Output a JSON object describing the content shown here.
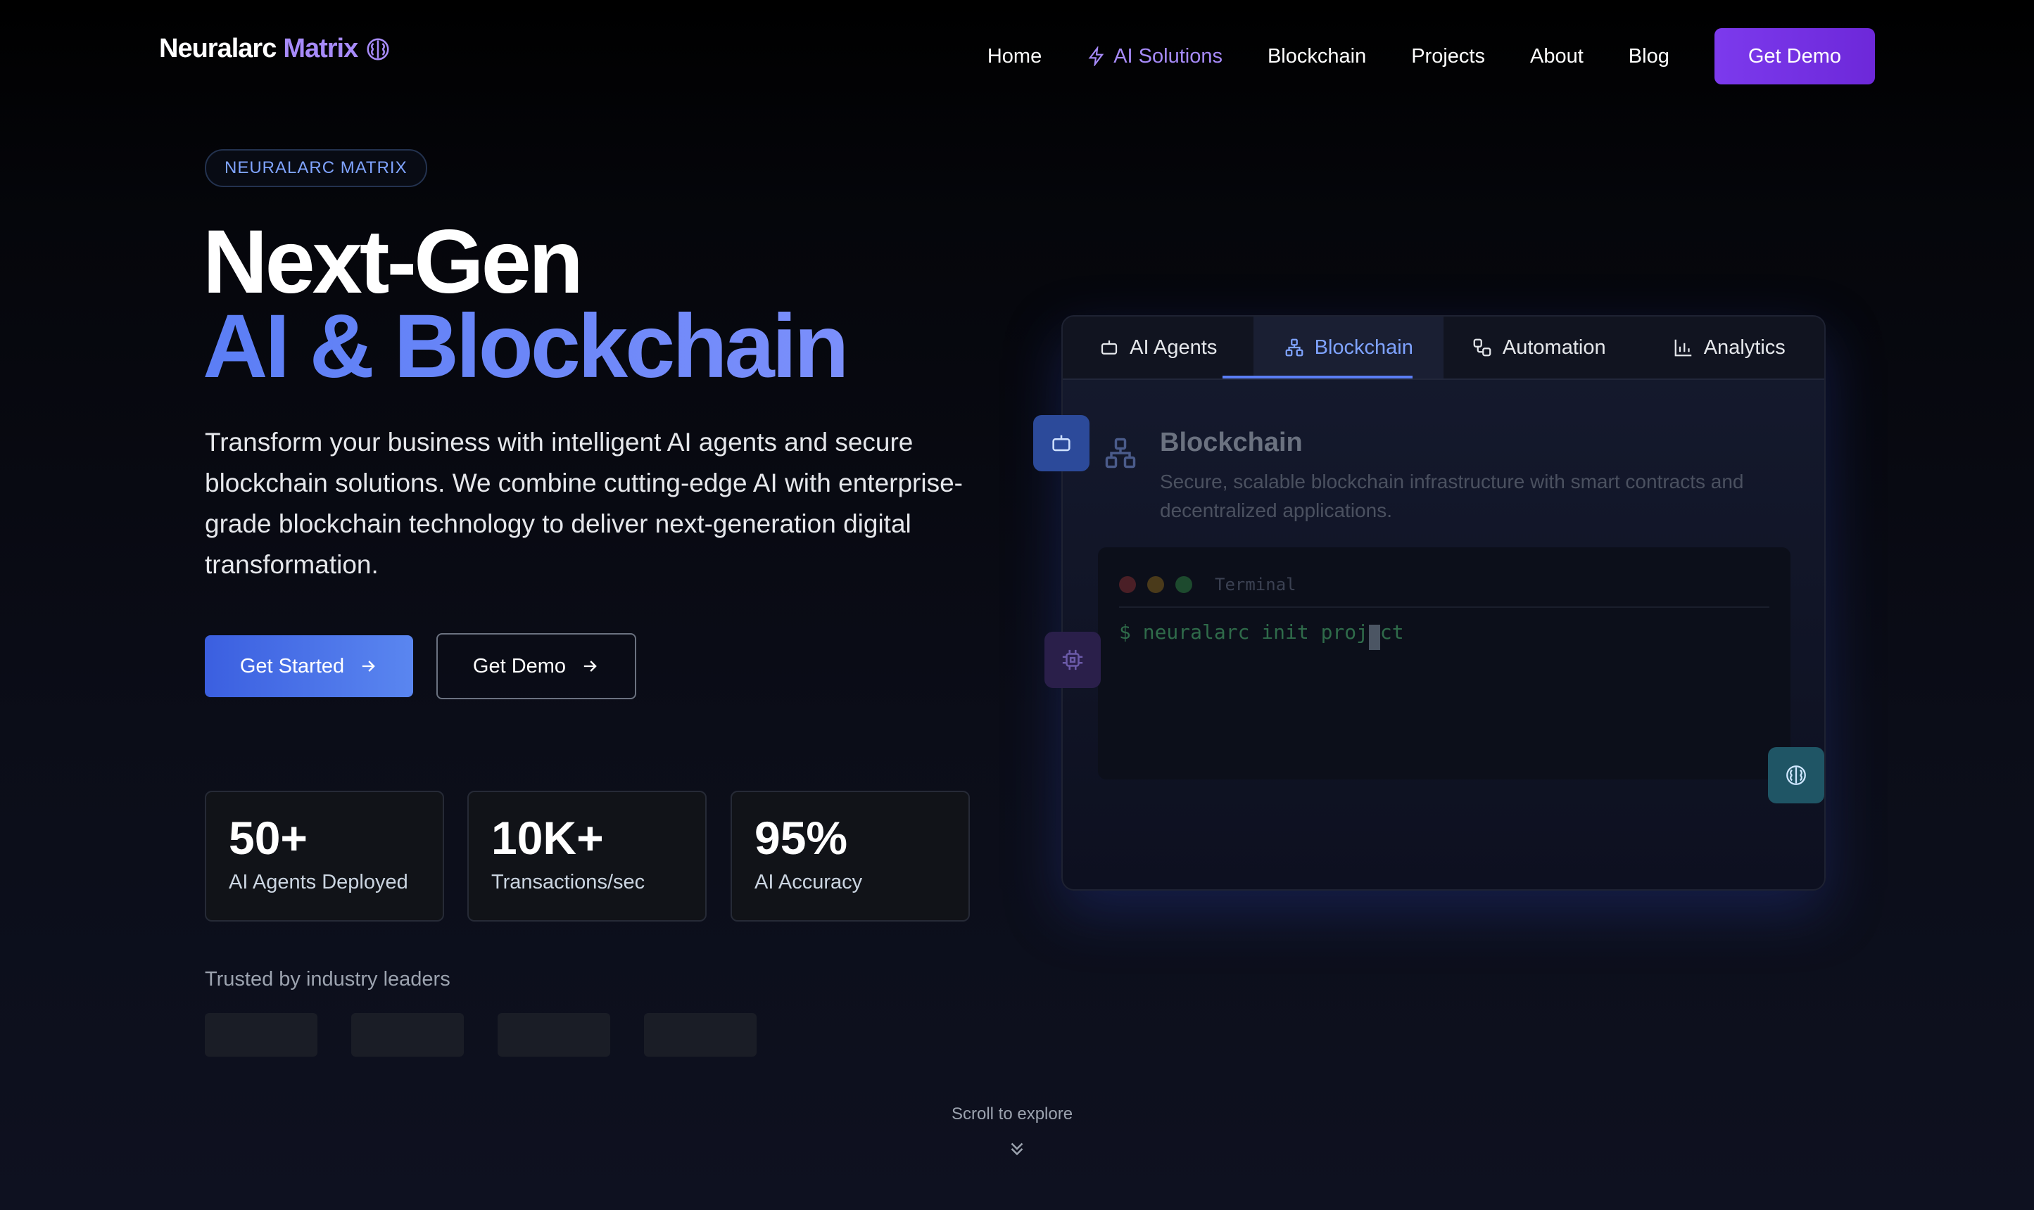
{
  "nav": {
    "logo_main": "Neuralarc",
    "logo_accent": "Matrix",
    "items": [
      "Home",
      "AI Solutions",
      "Blockchain",
      "Projects",
      "About",
      "Blog"
    ],
    "cta": "Get Demo"
  },
  "hero": {
    "badge": "NEURALARC MATRIX",
    "title_line1": "Next-Gen",
    "title_line2": "AI & Blockchain",
    "description": "Transform your business with intelligent AI agents and secure blockchain solutions. We combine cutting-edge AI with enterprise-grade blockchain technology to deliver next-generation digital transformation.",
    "primary_button": "Get Started",
    "secondary_button": "Get Demo",
    "stats": [
      {
        "value": "50+",
        "label": "AI Agents Deployed"
      },
      {
        "value": "10K+",
        "label": "Transactions/sec"
      },
      {
        "value": "95%",
        "label": "AI Accuracy"
      }
    ],
    "trusted": "Trusted by industry leaders",
    "scroll": "Scroll to explore"
  },
  "panel": {
    "tabs": [
      "AI Agents",
      "Blockchain",
      "Automation",
      "Analytics"
    ],
    "active_tab": "Blockchain",
    "title": "Blockchain",
    "description": "Secure, scalable blockchain infrastructure with smart contracts and decentralized applications.",
    "terminal_label": "Terminal",
    "terminal_command": "$ neuralarc init project"
  },
  "colors": {
    "accent_purple": "#a78bfa",
    "accent_blue": "#5b7ef5",
    "cta_purple": "#7c3aed"
  }
}
